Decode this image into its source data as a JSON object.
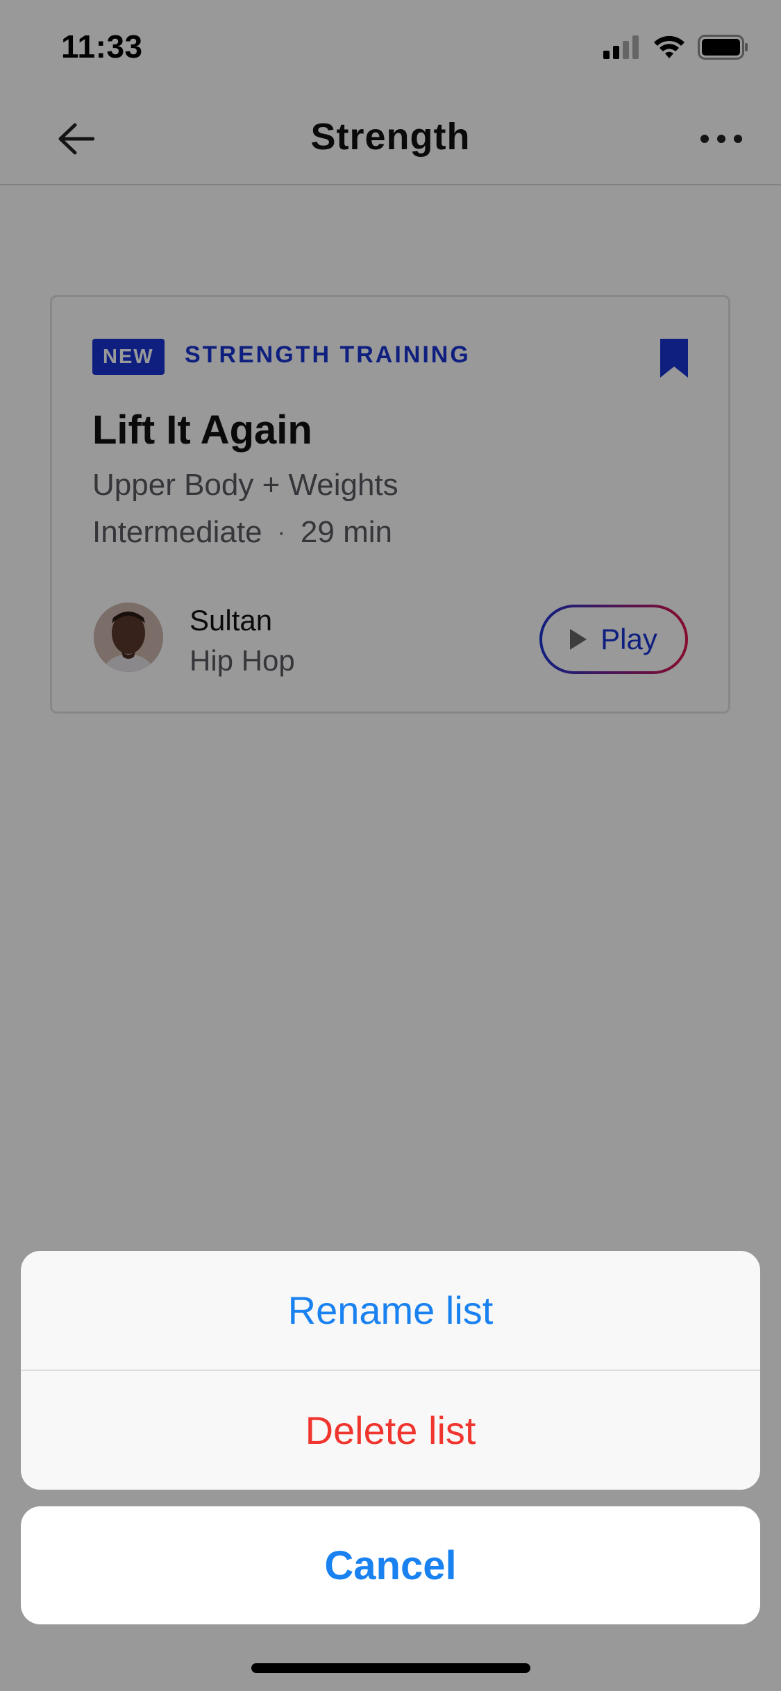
{
  "status_bar": {
    "time": "11:33",
    "icons": [
      "cellular-icon",
      "wifi-icon",
      "battery-icon"
    ]
  },
  "nav": {
    "title": "Strength",
    "back_icon": "arrow-left-icon",
    "more_icon": "more-horizontal-icon"
  },
  "card": {
    "badge": "NEW",
    "category": "STRENGTH TRAINING",
    "bookmark_icon": "bookmark-icon",
    "title": "Lift It Again",
    "subtitle": "Upper Body + Weights",
    "level": "Intermediate",
    "separator": "·",
    "duration": "29 min",
    "instructor": {
      "name": "Sultan",
      "genre": "Hip Hop"
    },
    "play_label": "Play",
    "play_icon": "play-icon"
  },
  "action_sheet": {
    "rename_label": "Rename list",
    "delete_label": "Delete list",
    "cancel_label": "Cancel"
  },
  "colors": {
    "brand_blue": "#1a35d4",
    "gradient_end": "#e0134c",
    "ios_blue": "#1a82f0",
    "destructive_red": "#f0352e",
    "overlay": "rgba(0,0,0,0.40)"
  }
}
